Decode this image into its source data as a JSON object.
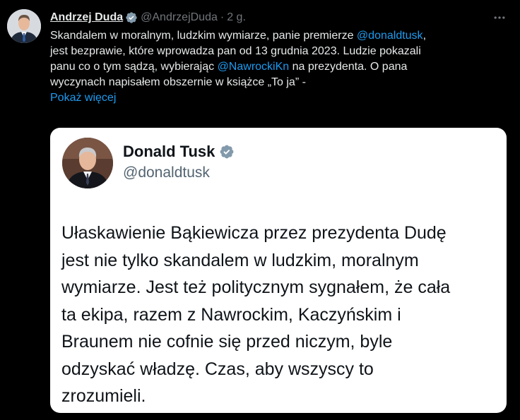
{
  "tweet": {
    "author_name": "Andrzej Duda",
    "author_handle": "@AndrzejDuda",
    "separator": "·",
    "time": "2 g.",
    "text_lines": [
      [
        "Skandalem w moralnym, ludzkim wymiarze, panie premierze ",
        "@donaldtusk",
        ","
      ],
      [
        "jest bezprawie, które wprowadza pan od 13 grudnia 2023. Ludzie pokazali"
      ],
      [
        "panu co o tym sądzą, wybierając ",
        "@NawrockiKn",
        " na prezydenta. O pana"
      ],
      [
        "wyczynach napisałem obszernie w książce „To ja” -"
      ]
    ],
    "show_more": "Pokaż więcej"
  },
  "quote": {
    "name": "Donald Tusk",
    "handle": "@donaldtusk",
    "text_lines": [
      "Ułaskawienie Bąkiewicza przez prezydenta Dudę",
      "jest nie tylko skandalem w ludzkim, moralnym",
      "wymiarze. Jest też politycznym sygnałem, że cała",
      "ta ekipa, razem z Nawrockim, Kaczyńskim i",
      "Braunem nie cofnie się przed niczym, byle",
      "odzyskać władzę. Czas, aby wszyscy to",
      "zrozumieli."
    ]
  },
  "colors": {
    "background": "#000000",
    "text": "#e7e9ea",
    "muted": "#71767b",
    "link": "#1d9bf0",
    "verified_gray": "#829aab"
  },
  "icons": {
    "verified": "verified-badge-icon",
    "more": "more-horizontal-icon"
  }
}
